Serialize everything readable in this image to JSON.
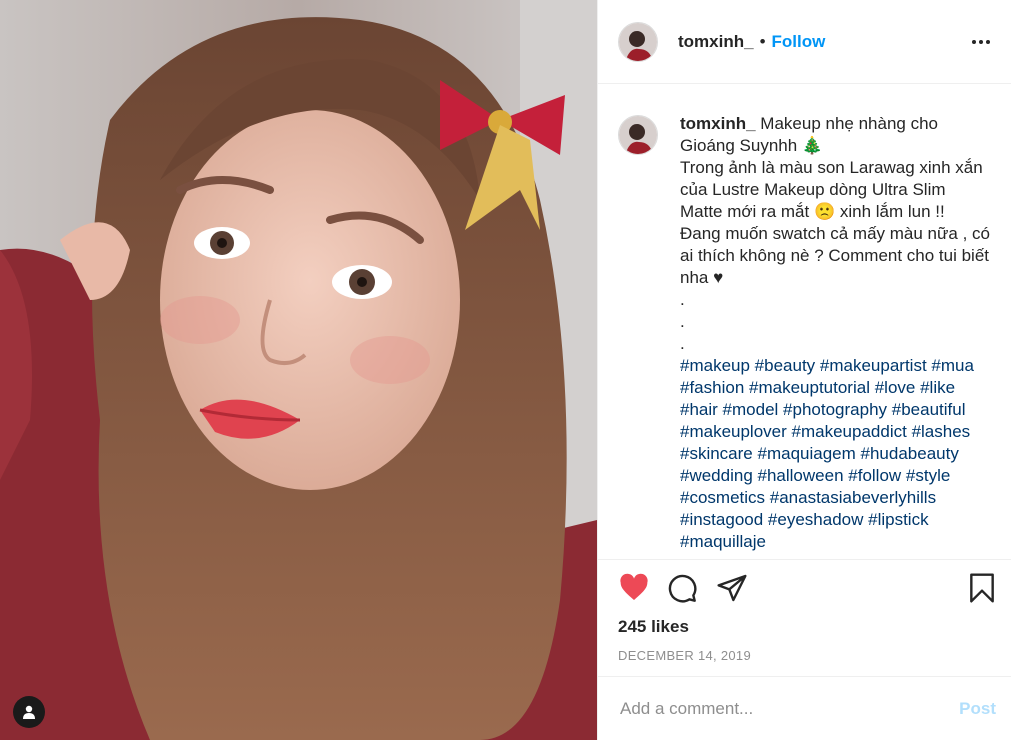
{
  "post": {
    "username": "tomxinh_",
    "dot": "•",
    "follow_label": "Follow",
    "more_icon": "more-horizontal-icon"
  },
  "caption": {
    "username": "tomxinh_",
    "line1": "Makeup nhẹ nhàng cho Gioáng Suynhh 🎄",
    "line2": "Trong ảnh là màu son Larawag xinh xắn của Lustre Makeup dòng Ultra Slim Matte mới ra mắt 🙁 xinh lắm lun !! Đang muốn swatch cả mấy màu nữa , có ai thích không nè ? Comment cho tui biết nha ♥",
    "dots": [
      ".",
      ".",
      "."
    ],
    "hashtags": [
      "#makeup",
      "#beauty",
      "#makeupartist",
      "#mua",
      "#fashion",
      "#makeuptutorial",
      "#love",
      "#like",
      "#hair",
      "#model",
      "#photography",
      "#beautiful",
      "#makeuplover",
      "#makeupaddict",
      "#lashes",
      "#skincare",
      "#maquiagem",
      "#hudabeauty",
      "#wedding",
      "#halloween",
      "#follow",
      "#style",
      "#cosmetics",
      "#anastasiabeverlyhills",
      "#instagood",
      "#eyeshadow",
      "#lipstick",
      "#maquillaje"
    ]
  },
  "actions": {
    "like_icon": "heart-filled-icon",
    "comment_icon": "comment-icon",
    "share_icon": "share-icon",
    "save_icon": "bookmark-icon"
  },
  "likes_text": "245 likes",
  "date": "DECEMBER 14, 2019",
  "comment": {
    "placeholder": "Add a comment...",
    "post_label": "Post"
  },
  "colors": {
    "like": "#ed4956",
    "link": "#0095f6",
    "hashtag": "#00376b",
    "post_disabled": "#b2dffc"
  }
}
